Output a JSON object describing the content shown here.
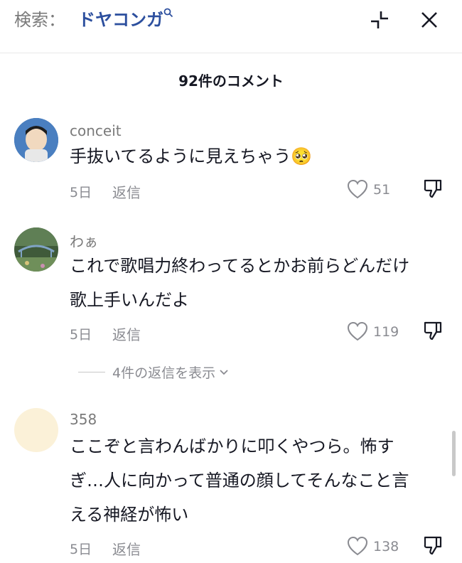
{
  "header": {
    "search_prefix": "検索：",
    "search_query": "ドヤコンガ",
    "search_icon": "search-icon",
    "collapse_icon": "collapse-icon",
    "close_icon": "close-icon"
  },
  "comment_count": "92件のコメント",
  "comments": [
    {
      "username": "conceit",
      "lines": [
        "手抜いてるように見えちゃう🥺"
      ],
      "date": "5日",
      "reply_label": "返信",
      "likes": "51"
    },
    {
      "username": "わぁ",
      "lines": [
        "これで歌唱力終わってるとかお前らどんだけ",
        "歌上手いんだよ"
      ],
      "date": "5日",
      "reply_label": "返信",
      "likes": "119",
      "view_replies": "4件の返信を表示"
    },
    {
      "username": "358",
      "lines": [
        "ここぞと言わんばかりに叩くやつら。怖す",
        "ぎ…人に向かって普通の顔してそんなこと言",
        "える神経が怖い"
      ],
      "date": "5日",
      "reply_label": "返信",
      "likes": "138"
    }
  ],
  "colors": {
    "accent": "#2c4f9e",
    "muted": "#8a8b91",
    "text": "#161823"
  }
}
